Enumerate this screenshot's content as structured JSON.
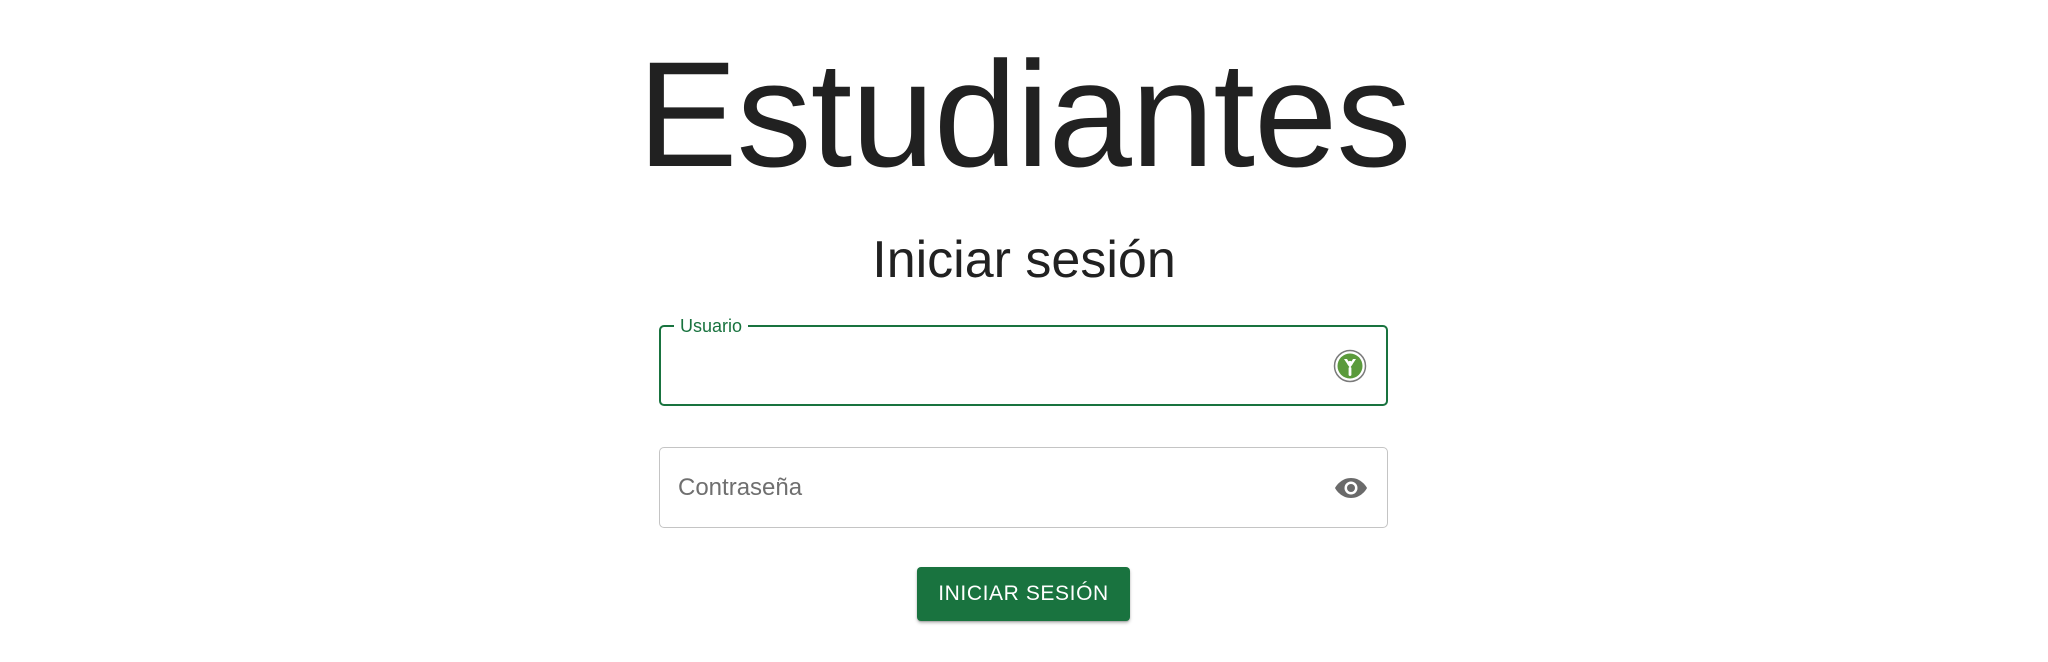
{
  "app_title": "Estudiantes",
  "login": {
    "heading": "Iniciar sesión",
    "username": {
      "label": "Usuario",
      "value": "",
      "icon": "password-manager-icon"
    },
    "password": {
      "placeholder": "Contraseña",
      "value": "",
      "icon": "eye-icon"
    },
    "submit_label": "INICIAR SESIÓN"
  },
  "colors": {
    "accent": "#19733f",
    "text": "#212121",
    "placeholder": "#6f6f6f",
    "border": "#c4c4c4"
  }
}
